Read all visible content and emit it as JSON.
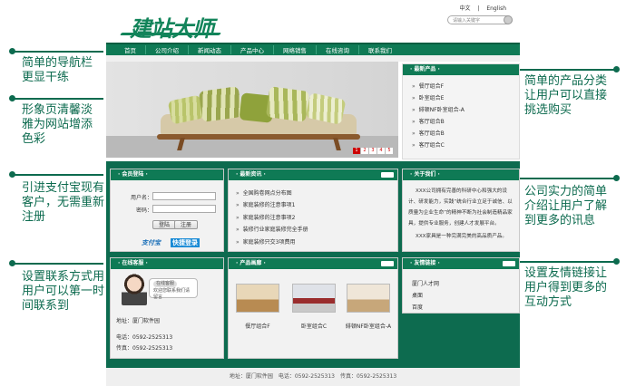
{
  "annotations": {
    "left": [
      "简单的导航栏更显干练",
      "形象页清馨淡雅为网站增添色彩",
      "引进支付宝现有客户，无需重新注册",
      "设置联系方式用用户可以第一时间联系到"
    ],
    "right": [
      "简单的产品分类让用户可以直接挑选购买",
      "公司实力的简单介绍让用户了解到更多的讯息",
      "设置友情链接让用户得到更多的互动方式"
    ]
  },
  "header": {
    "logo": "建站大师",
    "lang_zh": "中文",
    "lang_sep": "|",
    "lang_en": "English",
    "search_placeholder": "请输入关键字"
  },
  "nav": [
    "首页",
    "公司介绍",
    "新闻动态",
    "产品中心",
    "网络销售",
    "在线咨询",
    "联系我们"
  ],
  "banner": {
    "counter": [
      "1",
      "2",
      "3",
      "4",
      "5"
    ],
    "active": 1
  },
  "categories": {
    "title": "· 最新产品 ·",
    "items": [
      "餐厅组合F",
      "卧室组合E",
      "緋顿NF卧室组合-A",
      "客厅组合B",
      "客厅组合B",
      "客厅组合C"
    ]
  },
  "login": {
    "title": "· 会员登陆 ·",
    "username_label": "用户名：",
    "password_label": "密码：",
    "login_btn": "登陆",
    "register_btn": "注册",
    "alipay": "支付宝",
    "kuaijie": "快捷登录"
  },
  "news": {
    "title": "· 最新资讯 ·",
    "items": [
      "全国购卷网点分布图",
      "家庭装修的注意事项1",
      "家庭装修的注意事项2",
      "装修行业家庭装修完全手册",
      "家庭装修只交3项费用"
    ]
  },
  "about": {
    "title": "· 关于我们 ·",
    "text1": "XXX公司拥有完善的科研中心和强大的设计、研发能力，实践“统合行业立足于诚信、以质量为企业生命”的精神不断为社会制造精品家具，提供专业服务，创建人才发展平台。",
    "text2": "XXX家具是一种完满完美的高品质产品。"
  },
  "contact": {
    "title": "· 在线客服 ·",
    "bubble_tag": "在线客服",
    "bubble_text": "欢迎您联系我们请留言",
    "address": "地址：厦门软件园",
    "phone": "电话：0592-2525313",
    "fax": "传真：0592-2525313"
  },
  "products": {
    "title": "· 产品画廊 ·",
    "items": [
      "餐厅组合F",
      "卧室组合C",
      "緋顿NF卧室组合-A"
    ]
  },
  "links": {
    "title": "· 友情链接 ·",
    "items": [
      "厦门人才网",
      "桌面",
      "百度"
    ]
  },
  "footer": "地址：厦门软件园　电话：0592-2525313　传真：0592-2525313"
}
